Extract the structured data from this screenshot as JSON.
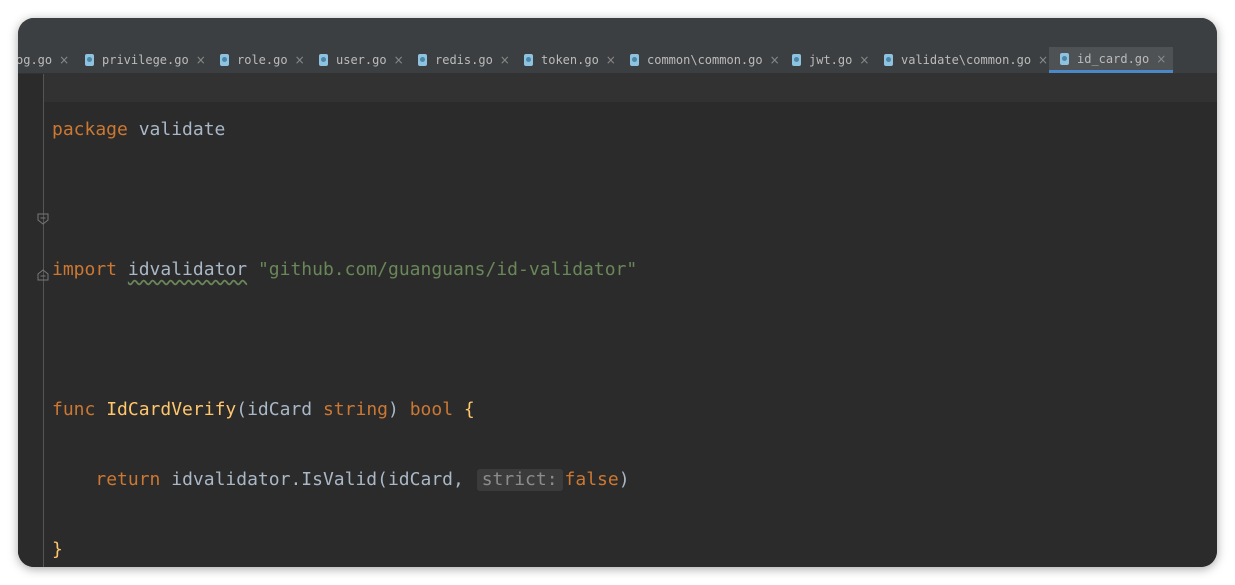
{
  "tabs": [
    {
      "label": "og.go",
      "active": false
    },
    {
      "label": "privilege.go",
      "active": false
    },
    {
      "label": "role.go",
      "active": false
    },
    {
      "label": "user.go",
      "active": false
    },
    {
      "label": "redis.go",
      "active": false
    },
    {
      "label": "token.go",
      "active": false
    },
    {
      "label": "common\\common.go",
      "active": false
    },
    {
      "label": "jwt.go",
      "active": false
    },
    {
      "label": "validate\\common.go",
      "active": false
    },
    {
      "label": "id_card.go",
      "active": true
    }
  ],
  "close_glyph": "×",
  "code": {
    "l1_kw": "package",
    "l1_name": "validate",
    "l3_kw": "import",
    "l3_alias": "idvalidator",
    "l3_path": "\"github.com/guanguans/id-validator\"",
    "l5_kw": "func",
    "l5_name": "IdCardVerify",
    "l5_open": "(",
    "l5_param": "idCard",
    "l5_type": "string",
    "l5_close": ")",
    "l5_ret": "bool",
    "l5_brace": "{",
    "l6_kw": "return",
    "l6_call": "idvalidator.IsValid(idCard,",
    "l6_hint": "strict:",
    "l6_val": "false",
    "l6_close": ")",
    "l7_brace": "}"
  },
  "colors": {
    "keyword": "#cc7832",
    "string": "#6a8759",
    "function": "#ffc66d",
    "default": "#a9b7c6",
    "tab_accent": "#4a88c7"
  }
}
